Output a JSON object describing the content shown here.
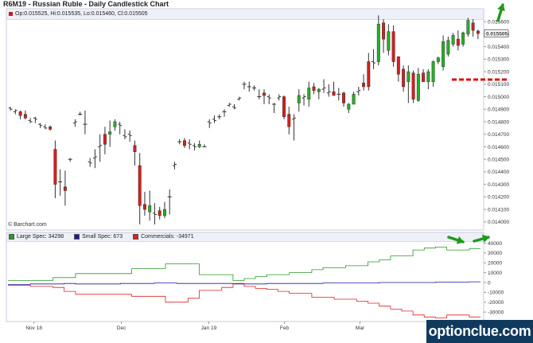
{
  "header": {
    "title": "R6M19 - Russian Ruble - Daily Candlestick Chart",
    "ohlc_text": "Op:0.015525, Hi:0.015535, Lo:0.015460, Cl:0.015505",
    "copyright": "© Barchart.com",
    "watermark": "optionclue.com"
  },
  "colors": {
    "up_candle": "#22b222",
    "down_candle": "#d81e1e",
    "bar_line": "#333333",
    "large_spec": "#2a9a2a",
    "small_spec": "#1a1a9a",
    "commercials": "#e02020",
    "annotation_arrow": "#1f9a1f",
    "annotation_dash": "#e01010"
  },
  "chart_data": [
    {
      "type": "candlestick",
      "title": "R6M19 - Russian Ruble - Daily Candlestick Chart",
      "x_tick_labels": [
        "Nov 18",
        "Dec",
        "Jan 19",
        "Feb",
        "Mar"
      ],
      "y_tick_labels": [
        "0.015600",
        "0.015500",
        "0.015400",
        "0.015300",
        "0.015200",
        "0.015100",
        "0.015000",
        "0.014900",
        "0.014800",
        "0.014700",
        "0.014600",
        "0.014500",
        "0.014400",
        "0.014300",
        "0.014200",
        "0.014100",
        "0.014000"
      ],
      "ylim": [
        0.01398,
        0.01562
      ],
      "last_price_label": "0.015505",
      "last_ohlc": {
        "open": 0.015525,
        "high": 0.015535,
        "low": 0.01546,
        "close": 0.015505
      },
      "bars": [
        {
          "o": 0.01491,
          "h": 0.01492,
          "l": 0.01489,
          "c": 0.0149
        },
        {
          "o": 0.01488,
          "h": 0.0149,
          "l": 0.01486,
          "c": 0.01489
        },
        {
          "o": 0.01488,
          "h": 0.01489,
          "l": 0.01482,
          "c": 0.01485
        },
        {
          "o": 0.01486,
          "h": 0.01489,
          "l": 0.01482,
          "c": 0.01483
        },
        {
          "o": 0.01481,
          "h": 0.01483,
          "l": 0.01479,
          "c": 0.0148
        },
        {
          "o": 0.01483,
          "h": 0.01484,
          "l": 0.01479,
          "c": 0.01482
        },
        {
          "o": 0.01478,
          "h": 0.01479,
          "l": 0.01475,
          "c": 0.01477
        },
        {
          "o": 0.01476,
          "h": 0.01478,
          "l": 0.01474,
          "c": 0.01475
        },
        {
          "o": 0.01476,
          "h": 0.01477,
          "l": 0.01473,
          "c": 0.01474
        },
        {
          "o": 0.01458,
          "h": 0.01465,
          "l": 0.01419,
          "c": 0.0143
        },
        {
          "o": 0.01432,
          "h": 0.01442,
          "l": 0.01421,
          "c": 0.01432
        },
        {
          "o": 0.01428,
          "h": 0.01441,
          "l": 0.01413,
          "c": 0.01425
        },
        {
          "o": 0.0145,
          "h": 0.01451,
          "l": 0.01448,
          "c": 0.0145
        },
        {
          "o": 0.01479,
          "h": 0.01482,
          "l": 0.01476,
          "c": 0.0148
        },
        {
          "o": 0.01486,
          "h": 0.01488,
          "l": 0.01485,
          "c": 0.01486
        },
        {
          "o": 0.01478,
          "h": 0.01489,
          "l": 0.0147,
          "c": 0.01478
        },
        {
          "o": 0.01448,
          "h": 0.01451,
          "l": 0.01444,
          "c": 0.01447
        },
        {
          "o": 0.01451,
          "h": 0.01458,
          "l": 0.01443,
          "c": 0.01452
        },
        {
          "o": 0.0146,
          "h": 0.0147,
          "l": 0.01448,
          "c": 0.01461
        },
        {
          "o": 0.0147,
          "h": 0.01476,
          "l": 0.01454,
          "c": 0.01462
        },
        {
          "o": 0.0147,
          "h": 0.01481,
          "l": 0.0146,
          "c": 0.01472
        },
        {
          "o": 0.01476,
          "h": 0.01482,
          "l": 0.01473,
          "c": 0.0148
        },
        {
          "o": 0.01478,
          "h": 0.0148,
          "l": 0.0147,
          "c": 0.01477
        },
        {
          "o": 0.01469,
          "h": 0.01474,
          "l": 0.01466,
          "c": 0.01468
        },
        {
          "o": 0.0147,
          "h": 0.01473,
          "l": 0.01464,
          "c": 0.01469
        },
        {
          "o": 0.01461,
          "h": 0.01465,
          "l": 0.01445,
          "c": 0.01456
        },
        {
          "o": 0.01445,
          "h": 0.01455,
          "l": 0.01398,
          "c": 0.01413
        },
        {
          "o": 0.01414,
          "h": 0.01424,
          "l": 0.01405,
          "c": 0.0141
        },
        {
          "o": 0.01408,
          "h": 0.01425,
          "l": 0.01401,
          "c": 0.01413
        },
        {
          "o": 0.01407,
          "h": 0.01415,
          "l": 0.01398,
          "c": 0.01406
        },
        {
          "o": 0.01409,
          "h": 0.01412,
          "l": 0.01402,
          "c": 0.01405
        },
        {
          "o": 0.01405,
          "h": 0.01416,
          "l": 0.01403,
          "c": 0.0141
        },
        {
          "o": 0.0142,
          "h": 0.01426,
          "l": 0.01406,
          "c": 0.0142
        },
        {
          "o": 0.01445,
          "h": 0.01448,
          "l": 0.01442,
          "c": 0.01446
        },
        {
          "o": 0.01464,
          "h": 0.01466,
          "l": 0.01462,
          "c": 0.01464
        },
        {
          "o": 0.01465,
          "h": 0.01467,
          "l": 0.01459,
          "c": 0.01461
        },
        {
          "o": 0.01463,
          "h": 0.01466,
          "l": 0.01458,
          "c": 0.01462
        },
        {
          "o": 0.01461,
          "h": 0.01463,
          "l": 0.01457,
          "c": 0.0146
        },
        {
          "o": 0.0146,
          "h": 0.01465,
          "l": 0.01459,
          "c": 0.01462
        },
        {
          "o": 0.0146,
          "h": 0.01462,
          "l": 0.0146,
          "c": 0.0146
        },
        {
          "o": 0.0148,
          "h": 0.01482,
          "l": 0.01475,
          "c": 0.01479
        },
        {
          "o": 0.01482,
          "h": 0.01485,
          "l": 0.01479,
          "c": 0.01481
        },
        {
          "o": 0.01484,
          "h": 0.01486,
          "l": 0.01482,
          "c": 0.01484
        },
        {
          "o": 0.01488,
          "h": 0.0149,
          "l": 0.01484,
          "c": 0.01488
        },
        {
          "o": 0.01493,
          "h": 0.01495,
          "l": 0.01492,
          "c": 0.01494
        },
        {
          "o": 0.01492,
          "h": 0.01494,
          "l": 0.0149,
          "c": 0.01491
        },
        {
          "o": 0.01498,
          "h": 0.015,
          "l": 0.01497,
          "c": 0.01499
        },
        {
          "o": 0.0151,
          "h": 0.01512,
          "l": 0.01506,
          "c": 0.0151
        },
        {
          "o": 0.01508,
          "h": 0.01512,
          "l": 0.01504,
          "c": 0.01508
        },
        {
          "o": 0.01507,
          "h": 0.01509,
          "l": 0.01505,
          "c": 0.01507
        },
        {
          "o": 0.015,
          "h": 0.01506,
          "l": 0.01498,
          "c": 0.015
        },
        {
          "o": 0.01503,
          "h": 0.01506,
          "l": 0.01494,
          "c": 0.01501
        },
        {
          "o": 0.015,
          "h": 0.01502,
          "l": 0.01494,
          "c": 0.01499
        },
        {
          "o": 0.01494,
          "h": 0.01495,
          "l": 0.01487,
          "c": 0.01494
        },
        {
          "o": 0.01499,
          "h": 0.01502,
          "l": 0.01497,
          "c": 0.015
        },
        {
          "o": 0.015,
          "h": 0.01501,
          "l": 0.01482,
          "c": 0.01484
        },
        {
          "o": 0.01486,
          "h": 0.01492,
          "l": 0.0147,
          "c": 0.01476
        },
        {
          "o": 0.01482,
          "h": 0.01486,
          "l": 0.01465,
          "c": 0.01483
        },
        {
          "o": 0.01495,
          "h": 0.01506,
          "l": 0.01488,
          "c": 0.01501
        },
        {
          "o": 0.01499,
          "h": 0.01502,
          "l": 0.01493,
          "c": 0.015
        },
        {
          "o": 0.01498,
          "h": 0.01512,
          "l": 0.01492,
          "c": 0.01507
        },
        {
          "o": 0.01508,
          "h": 0.01511,
          "l": 0.01502,
          "c": 0.01505
        },
        {
          "o": 0.01504,
          "h": 0.01507,
          "l": 0.01498,
          "c": 0.01506
        },
        {
          "o": 0.01506,
          "h": 0.01514,
          "l": 0.01503,
          "c": 0.01507
        },
        {
          "o": 0.01503,
          "h": 0.0151,
          "l": 0.015,
          "c": 0.01504
        },
        {
          "o": 0.01504,
          "h": 0.01512,
          "l": 0.01501,
          "c": 0.01501
        },
        {
          "o": 0.01502,
          "h": 0.01507,
          "l": 0.01497,
          "c": 0.01502
        },
        {
          "o": 0.01503,
          "h": 0.01504,
          "l": 0.01492,
          "c": 0.01495
        },
        {
          "o": 0.0149,
          "h": 0.01495,
          "l": 0.01487,
          "c": 0.01494
        },
        {
          "o": 0.01494,
          "h": 0.01504,
          "l": 0.01494,
          "c": 0.01502
        },
        {
          "o": 0.01504,
          "h": 0.01508,
          "l": 0.01501,
          "c": 0.01505
        },
        {
          "o": 0.01511,
          "h": 0.01518,
          "l": 0.01505,
          "c": 0.01508
        },
        {
          "o": 0.01528,
          "h": 0.01535,
          "l": 0.01505,
          "c": 0.01508
        },
        {
          "o": 0.01528,
          "h": 0.01538,
          "l": 0.01522,
          "c": 0.01527
        },
        {
          "o": 0.01528,
          "h": 0.01565,
          "l": 0.01525,
          "c": 0.01558
        },
        {
          "o": 0.01559,
          "h": 0.01562,
          "l": 0.01535,
          "c": 0.01546
        },
        {
          "o": 0.01537,
          "h": 0.01558,
          "l": 0.01533,
          "c": 0.01552
        },
        {
          "o": 0.01552,
          "h": 0.01557,
          "l": 0.01524,
          "c": 0.01528
        },
        {
          "o": 0.01532,
          "h": 0.01532,
          "l": 0.01512,
          "c": 0.01518
        },
        {
          "o": 0.01522,
          "h": 0.01525,
          "l": 0.01504,
          "c": 0.01508
        },
        {
          "o": 0.01512,
          "h": 0.01525,
          "l": 0.01495,
          "c": 0.0152
        },
        {
          "o": 0.01519,
          "h": 0.01521,
          "l": 0.01495,
          "c": 0.01498
        },
        {
          "o": 0.01497,
          "h": 0.01523,
          "l": 0.01496,
          "c": 0.01518
        },
        {
          "o": 0.01519,
          "h": 0.01522,
          "l": 0.01512,
          "c": 0.01512
        },
        {
          "o": 0.01512,
          "h": 0.01522,
          "l": 0.01506,
          "c": 0.0152
        },
        {
          "o": 0.01512,
          "h": 0.01529,
          "l": 0.01508,
          "c": 0.01528
        },
        {
          "o": 0.01528,
          "h": 0.01532,
          "l": 0.01526,
          "c": 0.01531
        },
        {
          "o": 0.01524,
          "h": 0.01549,
          "l": 0.01521,
          "c": 0.01544
        },
        {
          "o": 0.01534,
          "h": 0.01548,
          "l": 0.01532,
          "c": 0.01545
        },
        {
          "o": 0.01542,
          "h": 0.01551,
          "l": 0.0154,
          "c": 0.01549
        },
        {
          "o": 0.01546,
          "h": 0.01553,
          "l": 0.01537,
          "c": 0.01541
        },
        {
          "o": 0.01542,
          "h": 0.01552,
          "l": 0.0154,
          "c": 0.01551
        },
        {
          "o": 0.0155,
          "h": 0.01563,
          "l": 0.01548,
          "c": 0.01561
        },
        {
          "o": 0.01559,
          "h": 0.01562,
          "l": 0.01548,
          "c": 0.01553
        },
        {
          "o": 0.015525,
          "h": 0.015535,
          "l": 0.01546,
          "c": 0.015505
        }
      ]
    },
    {
      "type": "line",
      "step": true,
      "title": "",
      "legend": "top-left",
      "y_tick_labels": [
        "40000",
        "30000",
        "20000",
        "10000",
        "0",
        "-10000",
        "-20000",
        "-30000"
      ],
      "ylim": [
        -38000,
        42000
      ],
      "series": [
        {
          "name": "Large Spec: 34298",
          "values": [
            2000,
            2000,
            2000,
            2000,
            5000,
            5000,
            9000,
            9000,
            9000,
            9000,
            9000,
            14000,
            14000,
            14000,
            19000,
            19000,
            19000,
            8000,
            8000,
            8000,
            2000,
            4000,
            6000,
            8000,
            8000,
            10000,
            10000,
            13000,
            15000,
            15000,
            17000,
            17000,
            21000,
            23000,
            27000,
            27000,
            33000,
            35000,
            36000,
            33000,
            33000,
            34298
          ]
        },
        {
          "name": "Small Spec: 673",
          "values": [
            -2000,
            -2000,
            -1500,
            -1500,
            -1500,
            -1000,
            -1500,
            -1500,
            -1500,
            -1500,
            -1000,
            -1000,
            -1000,
            -500,
            -500,
            -1000,
            -1000,
            -1000,
            -1000,
            -1000,
            -1500,
            -1500,
            -1500,
            -1000,
            -1000,
            -1000,
            -1000,
            -1000,
            -500,
            -500,
            -500,
            -500,
            -500,
            0,
            0,
            0,
            0,
            0,
            500,
            500,
            500,
            673
          ]
        },
        {
          "name": "Commercials: -34971",
          "values": [
            -3000,
            -3000,
            -4000,
            -4000,
            -5000,
            -9000,
            -12000,
            -12000,
            -12000,
            -12000,
            -12000,
            -14000,
            -14000,
            -14000,
            -20000,
            -20000,
            -16000,
            -8000,
            -8000,
            -5000,
            -1000,
            -4000,
            -6000,
            -7000,
            -9000,
            -11000,
            -11000,
            -15000,
            -15000,
            -17000,
            -17000,
            -19000,
            -21000,
            -24000,
            -27000,
            -29000,
            -33000,
            -35000,
            -36000,
            -33000,
            -33000,
            -34971
          ]
        }
      ]
    }
  ]
}
